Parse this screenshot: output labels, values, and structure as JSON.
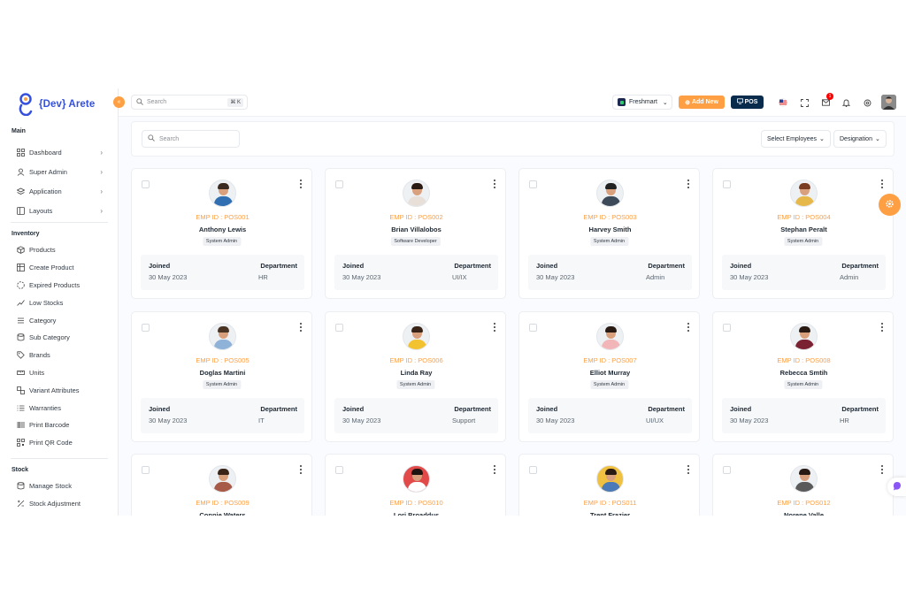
{
  "brand": {
    "name": "{Dev} Arete"
  },
  "header": {
    "search_placeholder": "Search",
    "search_shortcut": "⌘ K",
    "store": "Freshmart",
    "add_new": "Add New",
    "pos": "POS",
    "notification_count": "1"
  },
  "sidebar": {
    "main_title": "Main",
    "main_items": [
      {
        "label": "Dashboard",
        "icon": "grid-icon"
      },
      {
        "label": "Super Admin",
        "icon": "user-icon"
      },
      {
        "label": "Application",
        "icon": "layers-icon"
      },
      {
        "label": "Layouts",
        "icon": "layout-icon"
      }
    ],
    "inventory_title": "Inventory",
    "inventory_items": [
      {
        "label": "Products",
        "icon": "box-icon"
      },
      {
        "label": "Create Product",
        "icon": "table-icon"
      },
      {
        "label": "Expired Products",
        "icon": "progress-icon"
      },
      {
        "label": "Low Stocks",
        "icon": "trending-down-icon"
      },
      {
        "label": "Category",
        "icon": "list-icon"
      },
      {
        "label": "Sub Category",
        "icon": "stack-icon"
      },
      {
        "label": "Brands",
        "icon": "tag-icon"
      },
      {
        "label": "Units",
        "icon": "ruler-icon"
      },
      {
        "label": "Variant Attributes",
        "icon": "variant-icon"
      },
      {
        "label": "Warranties",
        "icon": "list-check-icon"
      },
      {
        "label": "Print Barcode",
        "icon": "barcode-icon"
      },
      {
        "label": "Print QR Code",
        "icon": "qrcode-icon"
      }
    ],
    "stock_title": "Stock",
    "stock_items": [
      {
        "label": "Manage Stock",
        "icon": "stack-icon"
      },
      {
        "label": "Stock Adjustment",
        "icon": "adjust-icon"
      }
    ]
  },
  "toolbar": {
    "search_placeholder": "Search",
    "select_employees": "Select Employees",
    "designation": "Designation"
  },
  "labels": {
    "joined": "Joined",
    "department": "Department"
  },
  "employees": [
    {
      "emp_id": "EMP ID : POS001",
      "name": "Anthony Lewis",
      "role": "System Admin",
      "joined": "30 May 2023",
      "department": "HR",
      "shirt": "#2f6fb2",
      "hair": "#3a2a20"
    },
    {
      "emp_id": "EMP ID : POS002",
      "name": "Brian Villalobos",
      "role": "Software Developer",
      "joined": "30 May 2023",
      "department": "UI/IX",
      "shirt": "#e8e0d8",
      "hair": "#2a1a14"
    },
    {
      "emp_id": "EMP ID : POS003",
      "name": "Harvey Smith",
      "role": "System Admin",
      "joined": "30 May 2023",
      "department": "Admin",
      "shirt": "#3c4a5a",
      "hair": "#222222"
    },
    {
      "emp_id": "EMP ID : POS004",
      "name": "Stephan Peralt",
      "role": "System Admin",
      "joined": "30 May 2023",
      "department": "Admin",
      "shirt": "#e6b84a",
      "hair": "#7a3b20"
    },
    {
      "emp_id": "EMP ID : POS005",
      "name": "Doglas Martini",
      "role": "System Admin",
      "joined": "30 May 2023",
      "department": "IT",
      "shirt": "#8fb3d8",
      "hair": "#4a3424"
    },
    {
      "emp_id": "EMP ID : POS006",
      "name": "Linda Ray",
      "role": "System Admin",
      "joined": "30 May 2023",
      "department": "Support",
      "shirt": "#f2c230",
      "hair": "#3a2418"
    },
    {
      "emp_id": "EMP ID : POS007",
      "name": "Elliot Murray",
      "role": "System Admin",
      "joined": "30 May 2023",
      "department": "UI/UX",
      "shirt": "#f3b6b8",
      "hair": "#2a1a14"
    },
    {
      "emp_id": "EMP ID : POS008",
      "name": "Rebecca Smtih",
      "role": "System Admin",
      "joined": "30 May 2023",
      "department": "HR",
      "shirt": "#7a2232",
      "hair": "#2a1a14"
    },
    {
      "emp_id": "EMP ID : POS009",
      "name": "Connie Waters",
      "role": "",
      "joined": "",
      "department": "",
      "shirt": "#a85a48",
      "hair": "#3a2418"
    },
    {
      "emp_id": "EMP ID : POS010",
      "name": "Lori Broaddus",
      "role": "",
      "joined": "",
      "department": "",
      "shirt": "#ffffff",
      "hair": "#1e1410",
      "bg": "#e24a4a"
    },
    {
      "emp_id": "EMP ID : POS011",
      "name": "Trent Frazier",
      "role": "",
      "joined": "",
      "department": "",
      "shirt": "#4a7ab8",
      "hair": "#2a1a14",
      "bg": "#f0c040"
    },
    {
      "emp_id": "EMP ID : POS012",
      "name": "Norene Valle",
      "role": "",
      "joined": "",
      "department": "",
      "shirt": "#5a5a5a",
      "hair": "#2a1a14"
    }
  ]
}
